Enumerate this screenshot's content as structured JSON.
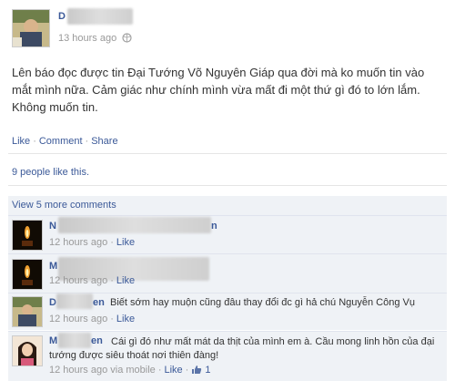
{
  "post": {
    "author_name": "D",
    "timestamp": "13 hours ago",
    "privacy_icon": "globe-icon",
    "text": "Lên báo đọc được tin Đại Tướng Võ Nguyên Giáp qua đời mà ko muốn tin vào mắt mình nữa. Cảm giác như chính mình vừa mất đi một thứ gì đó to lớn lắm. Không muốn tin.",
    "actions": {
      "like": "Like",
      "comment": "Comment",
      "share": "Share"
    }
  },
  "likes": {
    "text": "9 people like this."
  },
  "view_more": "View 5 more comments",
  "comments": [
    {
      "name": "N",
      "name_tail": "n",
      "text": "",
      "time": "12 hours ago",
      "like": "Like"
    },
    {
      "name": "M",
      "name_tail": "",
      "text": "",
      "time": "12 hours ago",
      "like": "Like"
    },
    {
      "name": "D",
      "name_tail": "en",
      "text": "Biết sớm hay muộn cũng đâu thay đổi đc gì hả chú Nguyễn Công Vụ",
      "time": "12 hours ago",
      "like": "Like"
    },
    {
      "name": "M",
      "name_tail": "en",
      "text": "Cái gì đó như mất mát da thịt của mình em à. Cầu mong linh hồn của đại tướng được siêu thoát nơi thiên đàng!",
      "time": "12 hours ago",
      "via": "via mobile",
      "like": "Like",
      "like_count": "1"
    }
  ],
  "colors": {
    "link": "#3b5998",
    "meta": "#999999",
    "comment_bg": "#eff2f6"
  }
}
